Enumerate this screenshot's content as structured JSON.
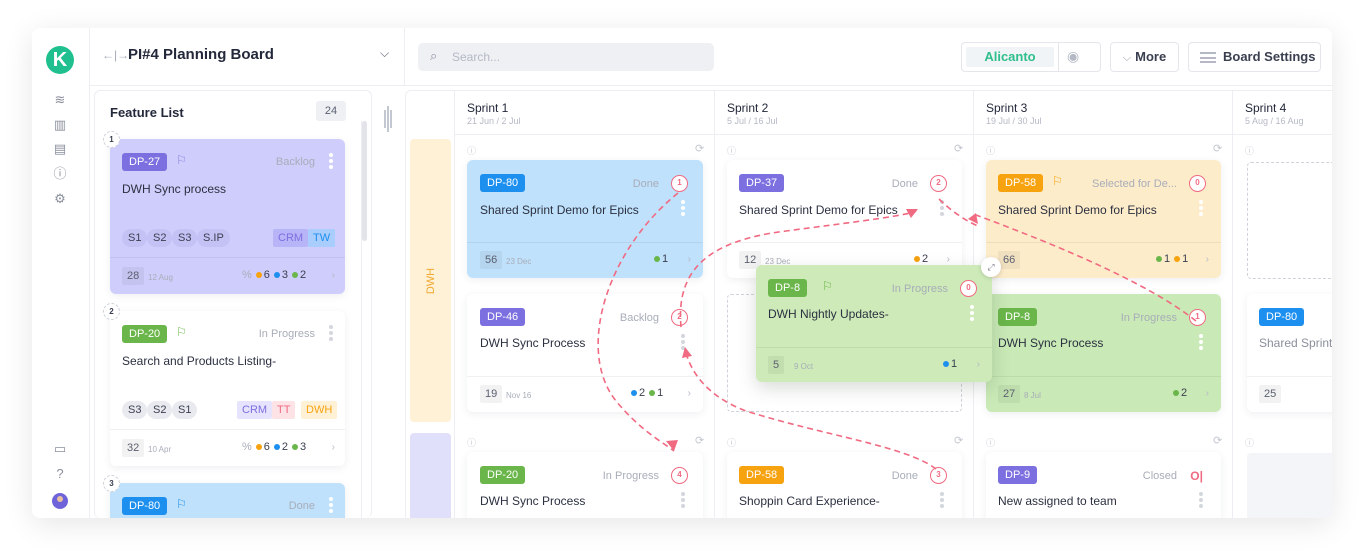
{
  "rail": {
    "logo": "K",
    "icons": [
      "layers-icon",
      "map-icon",
      "calendar-edit-icon",
      "alert-circle-icon",
      "gear-icon",
      "chat-icon",
      "help-icon"
    ]
  },
  "header": {
    "collapse_glyph": "←|→",
    "board_title": "PI#4 Planning Board",
    "dropdown_glyph": "⌵",
    "search_placeholder": "Search...",
    "team_name": "Alicanto",
    "more_label": "More",
    "settings_label": "Board Settings"
  },
  "feature_list": {
    "title": "Feature List",
    "count": "24",
    "items": [
      {
        "rank": "1",
        "id": "DP-27",
        "status": "Backlog",
        "title": "DWH Sync process",
        "sprints": [
          "S1",
          "S2",
          "S3",
          "S.IP"
        ],
        "components": [
          "CRM",
          "TW"
        ],
        "points": "28",
        "date": "12 Aug",
        "pct": "%",
        "stats": [
          "6",
          "3",
          "2"
        ],
        "color": "#cfcdfb",
        "tag_color": "#7c6fe0"
      },
      {
        "rank": "2",
        "id": "DP-20",
        "status": "In Progress",
        "title": "Search and Products Listing-",
        "sprints": [
          "S3",
          "S2",
          "S1"
        ],
        "components": [
          "CRM",
          "TT",
          "DWH"
        ],
        "points": "32",
        "date": "10 Apr",
        "pct": "%",
        "stats": [
          "6",
          "2",
          "3"
        ],
        "color": "#ffffff",
        "tag_color": "#6ab64a"
      },
      {
        "rank": "3",
        "id": "DP-80",
        "status": "Done",
        "color": "#bfe1fb",
        "tag_color": "#1d8fee"
      }
    ]
  },
  "lanes": [
    {
      "label": "DWH",
      "color": "#fff1d6"
    },
    {
      "label": "",
      "color": "#e1e0fb"
    }
  ],
  "sprints": [
    {
      "name": "Sprint 1",
      "dates": "21 Jun / 2 Jul"
    },
    {
      "name": "Sprint 2",
      "dates": "5 Jul / 16 Jul"
    },
    {
      "name": "Sprint 3",
      "dates": "19 Jul / 30 Jul"
    },
    {
      "name": "Sprint 4",
      "dates": "5 Aug / 16 Aug"
    }
  ],
  "cards": {
    "s1_r1": {
      "id": "DP-80",
      "status": "Done",
      "title": "Shared Sprint Demo for Epics",
      "points": "56",
      "date": "23 Dec",
      "stat": "1",
      "badge": "1"
    },
    "s2_r1": {
      "id": "DP-37",
      "status": "Done",
      "title": "Shared Sprint Demo for Epics",
      "points": "12",
      "date": "23 Dec",
      "stat": "2",
      "badge": "2"
    },
    "s3_r1": {
      "id": "DP-58",
      "status": "Selected for De...",
      "title": "Shared Sprint Demo for Epics",
      "points": "66",
      "stat1": "1",
      "stat2": "1",
      "badge": "0"
    },
    "s1_r2": {
      "id": "DP-46",
      "status": "Backlog",
      "title": "DWH Sync Process",
      "points": "19",
      "date": "Nov 16",
      "stat1": "2",
      "stat2": "1",
      "badge": "2"
    },
    "drag": {
      "id": "DP-8",
      "status": "In Progress",
      "title": "DWH Nightly Updates-",
      "points": "5",
      "date": "9 Oct",
      "stat": "1",
      "badge": "0"
    },
    "s3_r2": {
      "id": "DP-8",
      "status": "In Progress",
      "title": "DWH Sync Process",
      "points": "27",
      "date": "8 Jul",
      "stat": "2",
      "badge": "1"
    },
    "s4_r2": {
      "id": "DP-80",
      "title": "Shared Sprint",
      "points": "25"
    },
    "s1_r3": {
      "id": "DP-20",
      "status": "In Progress",
      "title": "DWH Sync Process",
      "badge": "4"
    },
    "s2_r3": {
      "id": "DP-58",
      "status": "Done",
      "title": "Shoppin Card Experience-",
      "badge": "3"
    },
    "s3_r3": {
      "id": "DP-9",
      "status": "Closed",
      "title": "New assigned to team"
    }
  },
  "colors": {
    "accent": "#1fbf8f",
    "dependency": "#f06a82",
    "purple": "#7c6fe0",
    "green": "#6ab64a",
    "blue": "#1d8fee",
    "orange": "#f7a20f"
  }
}
